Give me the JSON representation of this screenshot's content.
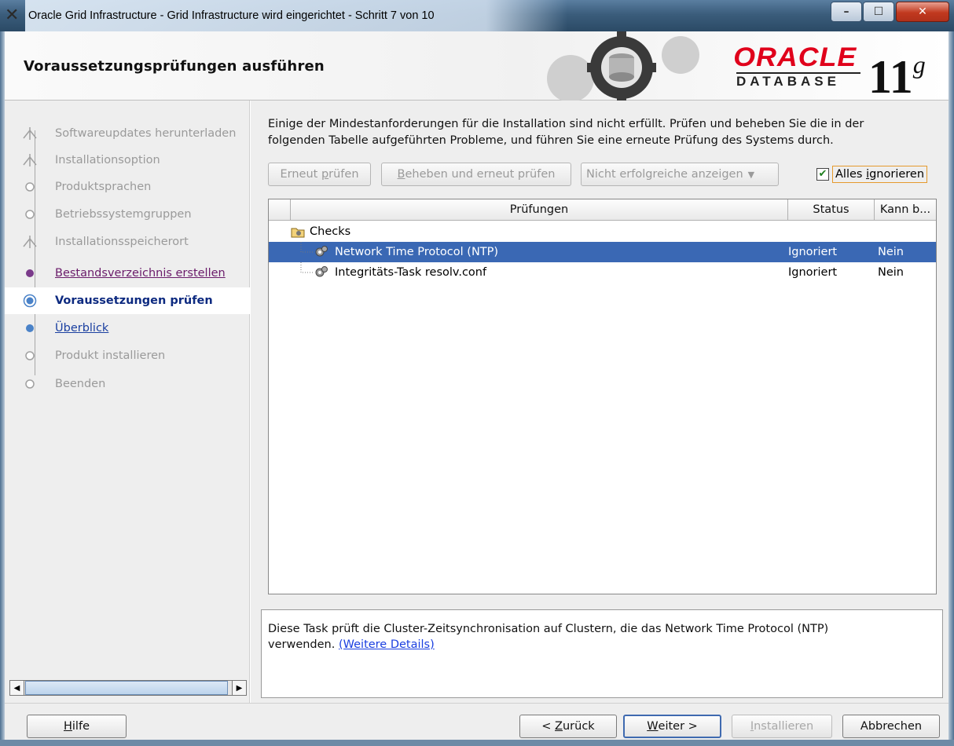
{
  "window": {
    "title": "Oracle Grid Infrastructure - Grid Infrastructure wird eingerichtet - Schritt 7 von 10",
    "controls": {
      "minimize": "–",
      "maximize": "☐",
      "close": "✕"
    }
  },
  "header": {
    "title": "Voraussetzungsprüfungen ausführen",
    "logo": {
      "brand": "ORACLE",
      "product": "DATABASE",
      "version": "11",
      "version_suffix": "g"
    }
  },
  "sidebar": {
    "steps": [
      {
        "label": "Softwareupdates herunterladen",
        "state": "disabled"
      },
      {
        "label": "Installationsoption",
        "state": "disabled"
      },
      {
        "label": "Produktsprachen",
        "state": "disabled"
      },
      {
        "label": "Betriebssystemgruppen",
        "state": "disabled"
      },
      {
        "label": "Installationsspeicherort",
        "state": "disabled"
      },
      {
        "label": "Bestandsverzeichnis erstellen",
        "state": "visited"
      },
      {
        "label": "Voraussetzungen prüfen",
        "state": "current"
      },
      {
        "label": "Überblick",
        "state": "link"
      },
      {
        "label": "Produkt installieren",
        "state": "disabled"
      },
      {
        "label": "Beenden",
        "state": "disabled"
      }
    ]
  },
  "main": {
    "description_line1": "Einige der Mindestanforderungen für die Installation sind nicht erfüllt. Prüfen und beheben Sie die in der",
    "description_line2": "folgenden Tabelle aufgeführten Probleme, und führen Sie eine erneute Prüfung des Systems durch.",
    "toolbar": {
      "recheck_pre": "Erneut ",
      "recheck_u": "p",
      "recheck_post": "rüfen",
      "fix_u": "B",
      "fix_post": "eheben und erneut prüfen",
      "filter": "Nicht erfolgreiche anzeigen",
      "ignore_all_pre": "Alles ",
      "ignore_all_u": "i",
      "ignore_all_post": "gnorieren",
      "ignore_all_checked": true
    },
    "table": {
      "columns": [
        "Prüfungen",
        "Status",
        "Kann b..."
      ],
      "group": "Checks",
      "rows": [
        {
          "check": "Network Time Protocol (NTP)",
          "status": "Ignoriert",
          "fixable": "Nein",
          "selected": true
        },
        {
          "check": "Integritäts-Task resolv.conf",
          "status": "Ignoriert",
          "fixable": "Nein",
          "selected": false
        }
      ]
    },
    "detail": {
      "text_line1": "Diese Task prüft die Cluster-Zeitsynchronisation auf Clustern, die das Network Time Protocol (NTP)",
      "text_line2": "verwenden. ",
      "link": "(Weitere Details)"
    }
  },
  "footer": {
    "help_u": "H",
    "help_post": "ilfe",
    "back_pre": "< ",
    "back_u": "Z",
    "back_post": "urück",
    "next_u": "W",
    "next_post": "eiter >",
    "install_u": "I",
    "install_post": "nstallieren",
    "cancel": "Abbrechen"
  },
  "colors": {
    "selection": "#3a68b4",
    "link": "#1a3fe0",
    "visited": "#6a1b6a",
    "oracle_red": "#e0001b"
  }
}
